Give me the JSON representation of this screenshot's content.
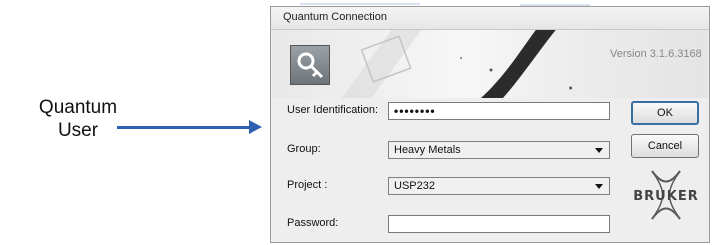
{
  "callout": {
    "text_line1": "Quantum",
    "text_line2": "User",
    "arrow_color": "#2f5fb0"
  },
  "dialog": {
    "title": "Quantum Connection",
    "version": "Version 3.1.6.3168",
    "fields": {
      "user_id_label": "User Identification:",
      "user_id_value": "••••••••",
      "group_label": "Group:",
      "group_value": "Heavy Metals",
      "project_label": "Project :",
      "project_value": "USP232",
      "password_label": "Password:",
      "password_value": ""
    },
    "buttons": {
      "ok": "OK",
      "cancel": "Cancel"
    },
    "logo_text": "BRUKER",
    "key_icon": "key-icon"
  }
}
